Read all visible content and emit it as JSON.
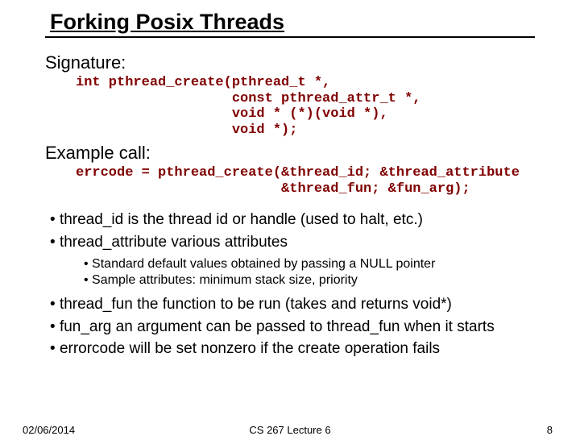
{
  "title": "Forking Posix Threads",
  "signature_label": "Signature:",
  "signature_code": "int pthread_create(pthread_t *,\n                   const pthread_attr_t *,\n                   void * (*)(void *),\n                   void *);",
  "example_label": "Example call:",
  "example_code": "errcode = pthread_create(&thread_id; &thread_attribute\n                         &thread_fun; &fun_arg);",
  "bullets": {
    "b1_pre": "thread_id  ",
    "b1_post": "is the thread id or handle (used to halt, etc.)",
    "b2_pre": "thread_attribute ",
    "b2_post": "various attributes",
    "b2_sub1": "Standard default values obtained by passing a NULL pointer",
    "b2_sub2": "Sample attributes: minimum stack size, priority",
    "b3_pre": "thread_fun ",
    "b3_post": "the function to be run (takes and returns void*)",
    "b4_pre": "fun_arg ",
    "b4_post": "an argument can be passed to thread_fun when it starts",
    "b5_pre": "errorcode ",
    "b5_post": "will be set nonzero if the create operation fails"
  },
  "footer": {
    "date": "02/06/2014",
    "lecture": "CS 267 Lecture 6",
    "page": "8"
  }
}
